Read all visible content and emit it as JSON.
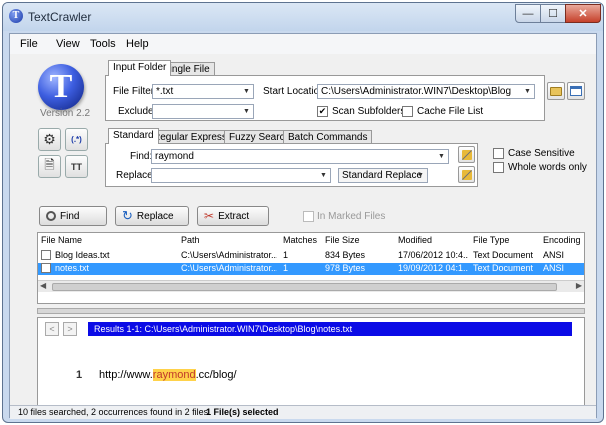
{
  "window": {
    "title": "TextCrawler",
    "min": "—",
    "max": "☐",
    "close": "✕",
    "app_icon": "T"
  },
  "menu": [
    "File",
    "View",
    "Tools",
    "Help"
  ],
  "logo": {
    "letter": "T",
    "version": "Version 2.2"
  },
  "side_buttons": [
    {
      "name": "settings-button",
      "icon": "⚙"
    },
    {
      "name": "regex-button",
      "icon": "(.*)"
    },
    {
      "name": "document-button",
      "icon": "🗎"
    },
    {
      "name": "text-size-button",
      "icon": "TT"
    }
  ],
  "source_tabs": {
    "active": "Input Folder",
    "other": "Single File"
  },
  "source": {
    "file_filter_label": "File Filter:",
    "file_filter_value": "*.txt",
    "start_location_label": "Start Location:",
    "start_location_value": "C:\\Users\\Administrator.WIN7\\Desktop\\Blog",
    "exclude_label": "Exclude:",
    "exclude_value": "",
    "scan_subfolders": "Scan Subfolders",
    "cache_file_list": "Cache File List"
  },
  "search_tabs": [
    "Standard",
    "Regular Expression",
    "Fuzzy Search",
    "Batch Commands"
  ],
  "search": {
    "find_label": "Find:",
    "find_value": "raymond",
    "replace_label": "Replace:",
    "replace_value": "",
    "replace_mode": "Standard Replace",
    "case_sensitive": "Case Sensitive",
    "whole_words": "Whole words only"
  },
  "actions": {
    "find": "Find",
    "replace": "Replace",
    "extract": "Extract",
    "in_marked": "In Marked Files"
  },
  "table": {
    "columns": [
      "File Name",
      "Path",
      "Matches",
      "File Size",
      "Modified",
      "File Type",
      "Encoding"
    ],
    "rows": [
      [
        "Blog Ideas.txt",
        "C:\\Users\\Administrator....",
        "1",
        "834 Bytes",
        "17/06/2012 10:4...",
        "Text Document",
        "ANSI"
      ],
      [
        "notes.txt",
        "C:\\Users\\Administrator....",
        "1",
        "978 Bytes",
        "19/09/2012 04:1...",
        "Text Document",
        "ANSI"
      ]
    ]
  },
  "results": {
    "prev": "<",
    "next": ">",
    "header": "Results 1-1: C:\\Users\\Administrator.WIN7\\Desktop\\Blog\\notes.txt",
    "line_no": "1",
    "line_before": "http://www.",
    "line_match": "raymond",
    "line_after": ".cc/blog/"
  },
  "status": {
    "summary": "10 files searched, 2 occurrences found in 2 files",
    "selected": "1 File(s) selected"
  },
  "colors": {
    "selection": "#3399ff",
    "result_bar": "#0b0be6",
    "match_highlight": "#ffd24a"
  }
}
